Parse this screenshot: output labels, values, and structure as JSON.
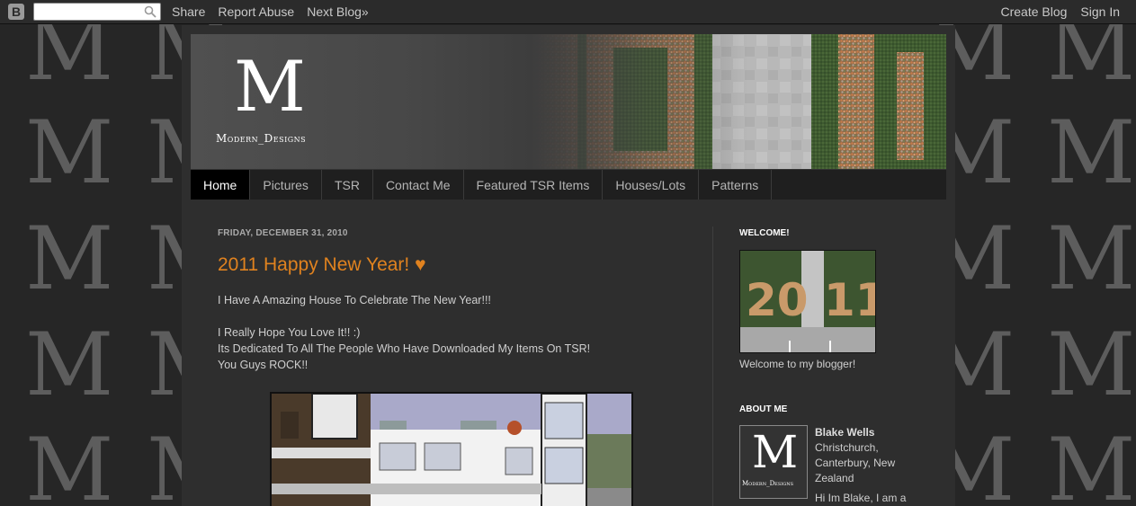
{
  "navbar": {
    "logo_letter": "B",
    "search_value": "",
    "links": [
      "Share",
      "Report Abuse",
      "Next Blog»"
    ],
    "right_links": [
      "Create Blog",
      "Sign In"
    ]
  },
  "background": {
    "letter": "M"
  },
  "header": {
    "logo_letter": "M",
    "logo_text": "Modern_Designs"
  },
  "tabs": [
    {
      "label": "Home",
      "active": true
    },
    {
      "label": "Pictures"
    },
    {
      "label": "TSR"
    },
    {
      "label": "Contact Me"
    },
    {
      "label": "Featured TSR Items"
    },
    {
      "label": "Houses/Lots"
    },
    {
      "label": "Patterns"
    }
  ],
  "post": {
    "date": "FRIDAY, DECEMBER 31, 2010",
    "title": "2011 Happy New Year! ♥",
    "lines": [
      "I Have A Amazing House To Celebrate The New Year!!!",
      "",
      "I Really Hope You Love It!! :)",
      "Its Dedicated To All The People Who Have Downloaded My Items On TSR!",
      "You Guys ROCK!!"
    ]
  },
  "sidebar": {
    "welcome_title": "WELCOME!",
    "welcome_image_text": "20  11",
    "welcome_text": "Welcome to my blogger!",
    "about_title": "ABOUT ME",
    "avatar_letter": "M",
    "avatar_text": "Modern_Designs",
    "name": "Blake Wells",
    "location": "Christchurch, Canterbury, New Zealand",
    "bio": "Hi Im Blake, I am a"
  },
  "colors": {
    "accent": "#e0821f",
    "background": "#262626"
  }
}
